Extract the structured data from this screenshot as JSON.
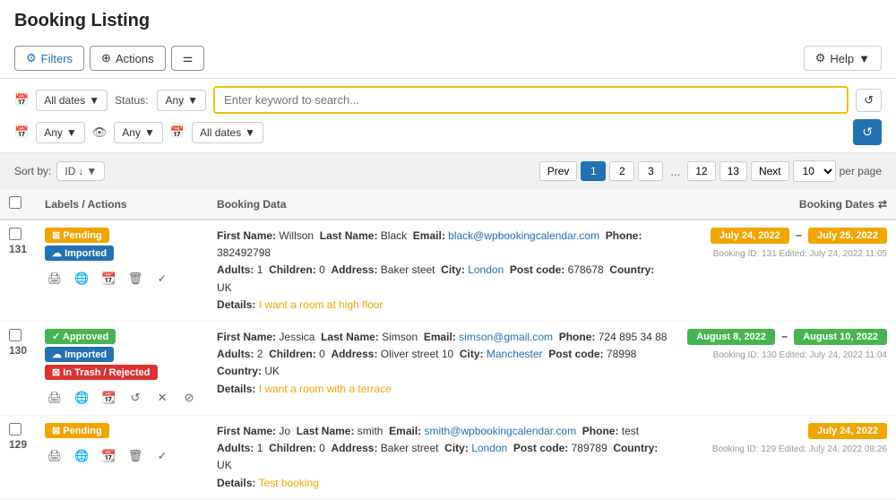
{
  "page": {
    "title": "Booking Listing"
  },
  "toolbar": {
    "filters_label": "Filters",
    "actions_label": "Actions",
    "help_label": "Help"
  },
  "filters": {
    "row1": {
      "dates_label": "All dates",
      "status_label": "Status:",
      "status_value": "Any",
      "search_placeholder": "Enter keyword to search..."
    },
    "row2": {
      "any1": "Any",
      "any2": "Any",
      "all_dates": "All dates"
    }
  },
  "sort_bar": {
    "sort_by_label": "Sort by:",
    "sort_value": "ID",
    "sort_dir": "↓",
    "prev_label": "Prev",
    "next_label": "Next",
    "pages": [
      "1",
      "2",
      "3",
      "...",
      "12",
      "13"
    ],
    "active_page": "1",
    "per_page": "10",
    "per_page_label": "per page"
  },
  "table": {
    "col_labels": "Labels / Actions",
    "col_data": "Booking Data",
    "col_dates": "Booking Dates"
  },
  "bookings": [
    {
      "id": "131",
      "status": "Pending",
      "status_type": "pending",
      "imported": true,
      "in_trash": false,
      "first_name_label": "First Name:",
      "first_name": "Willson",
      "last_name_label": "Last Name:",
      "last_name": "Black",
      "email_label": "Email:",
      "email": "black@wpbookingcalendar.com",
      "phone_label": "Phone:",
      "phone": "382492798",
      "adults_label": "Adults:",
      "adults": "1",
      "children_label": "Children:",
      "children": "0",
      "address_label": "Address:",
      "address": "Baker steet",
      "city_label": "City:",
      "city": "London",
      "postcode_label": "Post code:",
      "postcode": "678678",
      "country_label": "Country:",
      "country": "UK",
      "details_label": "Details:",
      "details": "I want a room at high floor",
      "date_start": "July 24, 2022",
      "date_end": "July 25, 2022",
      "date_start_type": "orange",
      "date_end_type": "orange",
      "single_date": false,
      "booking_meta": "Booking ID: 131  Edited: July 24, 2022 11:05"
    },
    {
      "id": "130",
      "status": "Approved",
      "status_type": "approved",
      "imported": true,
      "in_trash": true,
      "first_name_label": "First Name:",
      "first_name": "Jessica",
      "last_name_label": "Last Name:",
      "last_name": "Simson",
      "email_label": "Email:",
      "email": "simson@gmail.com",
      "phone_label": "Phone:",
      "phone": "724 895 34 88",
      "adults_label": "Adults:",
      "adults": "2",
      "children_label": "Children:",
      "children": "0",
      "address_label": "Address:",
      "address": "Oliver street 10",
      "city_label": "City:",
      "city": "Manchester",
      "postcode_label": "Post code:",
      "postcode": "78998",
      "country_label": "Country:",
      "country": "UK",
      "details_label": "Details:",
      "details": "I want a room with a terrace",
      "date_start": "August 8, 2022",
      "date_end": "August 10, 2022",
      "date_start_type": "green",
      "date_end_type": "green",
      "single_date": false,
      "booking_meta": "Booking ID: 130  Edited: July 24, 2022 11:04"
    },
    {
      "id": "129",
      "status": "Pending",
      "status_type": "pending",
      "imported": false,
      "in_trash": false,
      "first_name_label": "First Name:",
      "first_name": "Jo",
      "last_name_label": "Last Name:",
      "last_name": "smith",
      "email_label": "Email:",
      "email": "smith@wpbookingcalendar.com",
      "phone_label": "Phone:",
      "phone": "test",
      "adults_label": "Adults:",
      "adults": "1",
      "children_label": "Children:",
      "children": "0",
      "address_label": "Address:",
      "address": "Baker street",
      "city_label": "City:",
      "city": "London",
      "postcode_label": "Post code:",
      "postcode": "789789",
      "country_label": "Country:",
      "country": "UK",
      "details_label": "Details:",
      "details": "Test booking",
      "date_start": "July 24, 2022",
      "date_end": "",
      "date_start_type": "orange",
      "date_end_type": "",
      "single_date": true,
      "booking_meta": "Booking ID: 129  Edited: July 24, 2022 08:26"
    }
  ],
  "icons": {
    "filters": "⚙",
    "actions_icon": "⊕",
    "tune": "≡",
    "calendar": "📅",
    "eye": "👁",
    "help": "⚙",
    "refresh": "↺",
    "print": "🖨",
    "globe": "🌐",
    "cal_small": "📆",
    "trash": "🗑",
    "approve": "✓",
    "undo": "↺",
    "close": "✕",
    "block": "⊘",
    "cloud": "☁"
  },
  "colors": {
    "pending": "#f0a500",
    "approved": "#46b450",
    "imported": "#2271b1",
    "trash": "#dc3232",
    "accent": "#2271b1"
  }
}
